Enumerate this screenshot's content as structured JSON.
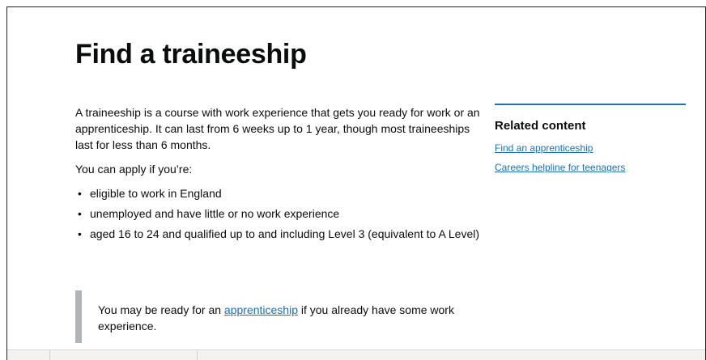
{
  "page": {
    "title": "Find a traineeship"
  },
  "main": {
    "intro": "A traineeship is a course with work experience that gets you ready for work or an apprenticeship. It can last from 6 weeks up to 1 year, though most traineeships last for less than 6 months.",
    "apply_lead": "You can apply if you’re:",
    "bullets": [
      "eligible to work in England",
      "unemployed and have little or no work experience",
      "aged 16 to 24 and qualified up to and including Level 3 (equivalent to A Level)"
    ],
    "inset": {
      "before": "You may be ready for an ",
      "link": "apprenticeship",
      "after": " if you already have some work experience."
    }
  },
  "related": {
    "heading": "Related content",
    "links": [
      "Find an apprenticeship",
      "Careers helpline for teenagers"
    ]
  },
  "colors": {
    "link": "#1d70b8",
    "text": "#0b0c0c",
    "inset_border": "#b1b4b6",
    "related_border": "#1d70b8"
  }
}
